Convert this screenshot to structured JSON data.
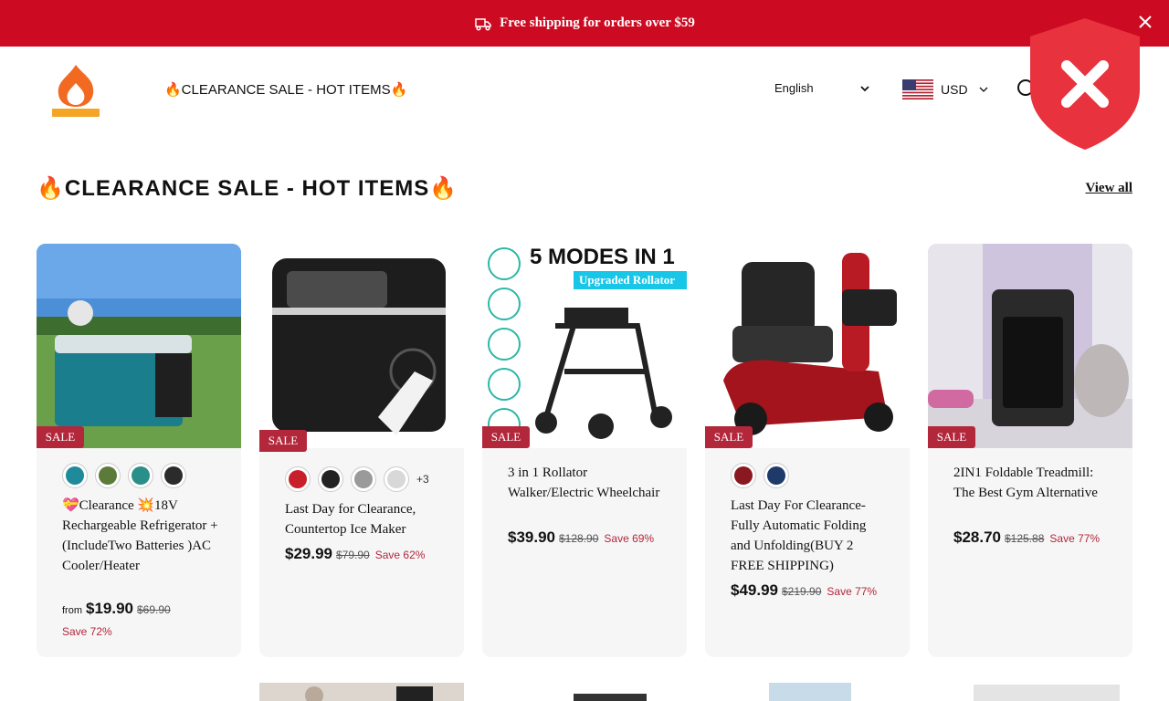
{
  "announcement": {
    "text": "Free shipping for orders over $59",
    "icon": "truck-icon"
  },
  "header": {
    "logo_alt": "HOPLUS",
    "nav_link": "🔥CLEARANCE SALE - HOT ITEMS🔥",
    "language": "English",
    "currency": "USD"
  },
  "section": {
    "title": "🔥CLEARANCE SALE - HOT ITEMS🔥",
    "view_all": "View all"
  },
  "products": [
    {
      "badge": "SALE",
      "swatches": [
        "#1f8a9a",
        "#5c7a3a",
        "#2a8f88",
        "#2b2b2b"
      ],
      "extra_swatches": "",
      "name": "💝Clearance 💥18V Rechargeable Refrigerator + (IncludeTwo Batteries )AC Cooler/Heater",
      "from": "from",
      "price": "$19.90",
      "compare": "$69.90",
      "save": "Save 72%"
    },
    {
      "badge": "SALE",
      "swatches": [
        "#c8202a",
        "#222222",
        "#9a9a9a",
        "#d8d8d8"
      ],
      "extra_swatches": "+3",
      "name": "Last Day for Clearance, Countertop Ice Maker",
      "from": "",
      "price": "$29.99",
      "compare": "$79.90",
      "save": "Save 62%"
    },
    {
      "badge": "SALE",
      "swatches": [],
      "extra_swatches": "",
      "name": "3 in 1 Rollator Walker/Electric Wheelchair",
      "from": "",
      "price": "$39.90",
      "compare": "$128.90",
      "save": "Save 69%",
      "image_heading": "5 MODES IN 1",
      "image_tag": "Upgraded Rollator"
    },
    {
      "badge": "SALE",
      "swatches": [
        "#8a1820",
        "#1d3a6a"
      ],
      "extra_swatches": "",
      "name": "Last Day For Clearance-Fully Automatic Folding and Unfolding(BUY 2 FREE SHIPPING)",
      "from": "",
      "price": "$49.99",
      "compare": "$219.90",
      "save": "Save 77%"
    },
    {
      "badge": "SALE",
      "swatches": [],
      "extra_swatches": "",
      "name": "2IN1 Foldable Treadmill: The Best Gym Alternative",
      "from": "",
      "price": "$28.70",
      "compare": "$125.88",
      "save": "Save 77%"
    }
  ],
  "colors": {
    "announcement_bg": "#cc0b22",
    "sale_badge": "#b3273b",
    "shield": "#e8323e"
  }
}
